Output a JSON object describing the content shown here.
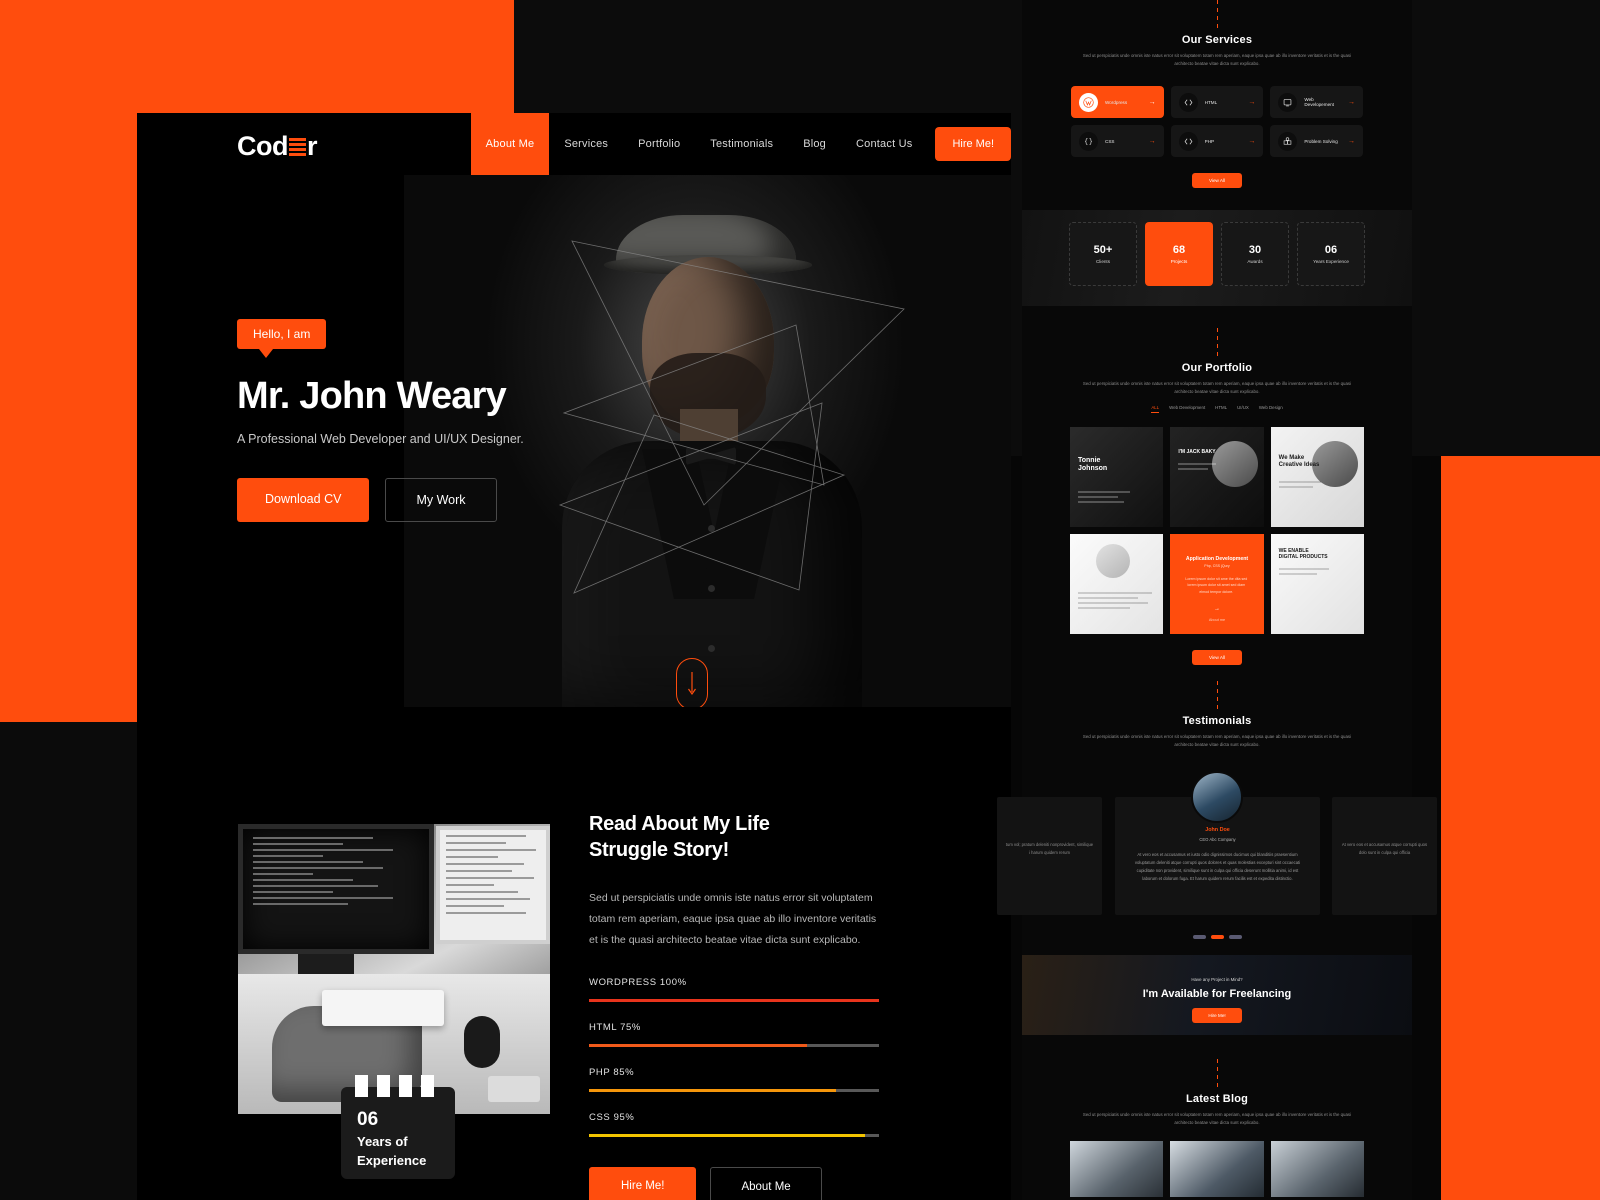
{
  "brand": {
    "name_part1": "Cod",
    "name_part2": "r",
    "accent_color": "#FF4D0D"
  },
  "nav": {
    "items": [
      {
        "label": "About Me",
        "active": true
      },
      {
        "label": "Services",
        "active": false
      },
      {
        "label": "Portfolio",
        "active": false
      },
      {
        "label": "Testimonials",
        "active": false
      },
      {
        "label": "Blog",
        "active": false
      },
      {
        "label": "Contact Us",
        "active": false
      }
    ],
    "cta": "Hire Me!"
  },
  "hero": {
    "badge": "Hello, I am",
    "name": "Mr. John Weary",
    "subtitle": "A Professional Web Developer and UI/UX Designer.",
    "primary_button": "Download CV",
    "secondary_button": "My Work",
    "scroll_icon": "arrow-down-icon"
  },
  "about": {
    "title_line1": "Read About My Life",
    "title_line2": "Struggle Story!",
    "paragraph": "Sed ut perspiciatis unde omnis iste natus error sit voluptatem  totam rem aperiam, eaque ipsa quae ab illo inventore veritatis et is the quasi architecto beatae vitae dicta sunt explicabo.",
    "experience_badge": {
      "number": "06",
      "line1": "Years of",
      "line2": "Experience"
    },
    "skills": [
      {
        "label": "WORDPRESS 100%",
        "value": 100,
        "color": "#E8341C"
      },
      {
        "label": "HTML 75%",
        "value": 75,
        "color": "#F05A1A"
      },
      {
        "label": "PHP 85%",
        "value": 85,
        "color": "#F5960B"
      },
      {
        "label": "CSS 95%",
        "value": 95,
        "color": "#F2C400"
      }
    ],
    "primary_button": "Hire Me!",
    "secondary_button": "About Me"
  },
  "services": {
    "title": "Our Services",
    "description": "Sed ut perspiciatis unde omnis iste natus error sit voluptatem  totam rem aperiam, eaque ipsa quae ab illo inventore veritatis et is the quasi architecto beatae vitae dicta sunt explicabo.",
    "items": [
      {
        "label": "Wordpress",
        "icon": "wordpress-icon",
        "active": true
      },
      {
        "label": "HTML",
        "icon": "code-tag-icon",
        "active": false
      },
      {
        "label": "Web Developement",
        "icon": "monitor-icon",
        "active": false
      },
      {
        "label": "CSS",
        "icon": "braces-icon",
        "active": false
      },
      {
        "label": "PHP",
        "icon": "code-tag-icon",
        "active": false
      },
      {
        "label": "Problem Solving",
        "icon": "puzzle-icon",
        "active": false
      }
    ],
    "view_all": "View All"
  },
  "stats": [
    {
      "number": "50+",
      "label": "Clients",
      "active": false
    },
    {
      "number": "68",
      "label": "Projects",
      "active": true
    },
    {
      "number": "30",
      "label": "Awards",
      "active": false
    },
    {
      "number": "06",
      "label": "Years Experience",
      "active": false
    }
  ],
  "portfolio": {
    "title": "Our Portfolio",
    "description": "Sed ut perspiciatis unde omnis iste natus error sit voluptatem  totam rem aperiam, eaque ipsa quae ab illo inventore veritatis et is the quasi architecto beatae vitae dicta sunt explicabo.",
    "filters": [
      {
        "label": "ALL",
        "active": true
      },
      {
        "label": "Web Development",
        "active": false
      },
      {
        "label": "HTML",
        "active": false
      },
      {
        "label": "UI/UX",
        "active": false
      },
      {
        "label": "Web Design",
        "active": false
      }
    ],
    "items": [
      {
        "caption": "Tonnie\nJohnson"
      },
      {
        "caption": "I'M JACK BAKY"
      },
      {
        "caption": "We Make\nCreative Ideas"
      },
      {
        "caption": ""
      },
      {
        "caption": "Application Development",
        "subtitle": "Php, CSS jQury",
        "body": "Lorem ipsum dolor sit ame the dita sed lorem ipsum dolor sit amet sed diam  elmod tempor dolore.",
        "link": "About me"
      },
      {
        "caption": "WE ENABLE\nDIGITAL PRODUCTS"
      }
    ],
    "view_all": "View All"
  },
  "testimonials": {
    "title": "Testimonials",
    "description": "Sed ut perspiciatis unde omnis iste natus error sit voluptatem  totam rem aperiam, eaque ipsa quae ab illo inventore veritatis et is the quasi architecto beatae vitae dicta sunt explicabo.",
    "active": {
      "name": "John Doe",
      "role": "CEO Abc Company",
      "quote": "At vero eos et accusamus et iusto odio dignissimos ducimus qui blanditiis praesentium voluptatum deleniti atque corrupti quos dolores et quas molestias excepturi sint occaecati cupiditate non provident, similique sunt in culpa qui officia deserunt mollitia animi, id est laborum et dolorum fuga. Et harum quidem rerum facilis est et expedita distinctio."
    },
    "side_left": "tum vol; pratum deleniti nonprovident, similique i harum quidem rerum",
    "side_right": "At vero eos et accusamus atque corrupti quos dolo sunt in culpa qui officia",
    "dots": [
      {
        "active": false
      },
      {
        "active": true
      },
      {
        "active": false
      }
    ]
  },
  "cta": {
    "eyebrow": "Have any Project in Mind?",
    "headline": "I'm Available for Freelancing",
    "button": "Hire Me!"
  },
  "blog": {
    "title": "Latest Blog",
    "description": "Sed ut perspiciatis unde omnis iste natus error sit voluptatem  totam rem aperiam, eaque ipsa quae ab illo inventore veritatis et is the quasi architecto beatae vitae dicta sunt explicabo."
  }
}
